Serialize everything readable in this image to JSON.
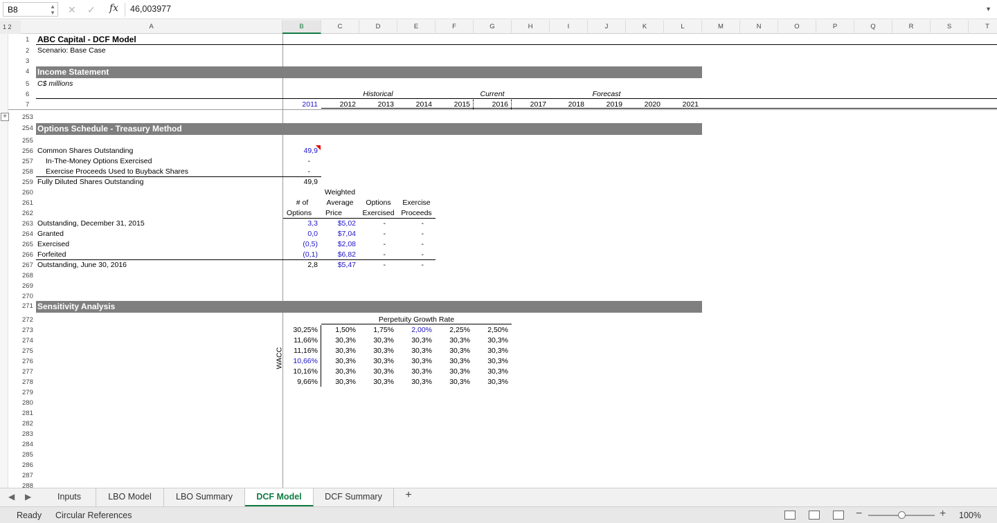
{
  "formula_bar": {
    "name_box": "B8",
    "formula": "46,003977",
    "fx_label": "fx"
  },
  "columns": [
    "A",
    "B",
    "C",
    "D",
    "E",
    "F",
    "G",
    "H",
    "I",
    "J",
    "K",
    "L",
    "M",
    "N",
    "O",
    "P",
    "Q",
    "R",
    "S",
    "T"
  ],
  "outline_levels": "1 2",
  "row_numbers": [
    "1",
    "2",
    "3",
    "4",
    "5",
    "6",
    "7",
    "253",
    "254",
    "255",
    "256",
    "257",
    "258",
    "259",
    "260",
    "261",
    "262",
    "263",
    "264",
    "265",
    "266",
    "267",
    "268",
    "269",
    "270",
    "271",
    "272",
    "273",
    "274",
    "275",
    "276",
    "277",
    "278",
    "279",
    "280",
    "281",
    "282",
    "283",
    "284",
    "285",
    "286",
    "287",
    "288"
  ],
  "header": {
    "title": "ABC Capital - DCF Model",
    "scenario": "Scenario: Base Case",
    "income_statement": "Income Statement",
    "units": "C$ millions",
    "historical": "Historical",
    "current": "Current",
    "forecast": "Forecast",
    "years": [
      "2011",
      "2012",
      "2013",
      "2014",
      "2015",
      "2016",
      "2017",
      "2018",
      "2019",
      "2020",
      "2021"
    ]
  },
  "options": {
    "title": "Options Schedule - Treasury Method",
    "common_label": "Common Shares Outstanding",
    "common_value": "49,9",
    "itm_label": "In-The-Money Options Exercised",
    "itm_value": "-",
    "proceeds_label": "Exercise Proceeds Used to Buyback Shares",
    "proceeds_value": "-",
    "diluted_label": "Fully Diluted Shares Outstanding",
    "diluted_value": "49,9",
    "col_headers": {
      "num_1": "# of",
      "num_2": "Options",
      "wap_1": "Weighted",
      "wap_2": "Average",
      "wap_3": "Price",
      "ex_1": "Options",
      "ex_2": "Exercised",
      "pr_1": "Exercise",
      "pr_2": "Proceeds"
    },
    "rows": [
      {
        "label": "Outstanding, December 31, 2015",
        "num": "3,3",
        "price": "$5,02",
        "exercised": "-",
        "proceeds": "-"
      },
      {
        "label": "Granted",
        "num": "0,0",
        "price": "$7,04",
        "exercised": "-",
        "proceeds": "-"
      },
      {
        "label": "Exercised",
        "num": "(0,5)",
        "price": "$2,08",
        "exercised": "-",
        "proceeds": "-"
      },
      {
        "label": "Forfeited",
        "num": "(0,1)",
        "price": "$6,82",
        "exercised": "-",
        "proceeds": "-"
      },
      {
        "label": "Outstanding, June 30, 2016",
        "num": "2,8",
        "price": "$5,47",
        "exercised": "-",
        "proceeds": "-"
      }
    ]
  },
  "sensitivity": {
    "title": "Sensitivity Analysis",
    "pgr_label": "Perpetuity Growth Rate",
    "wacc_label": "WACC",
    "corner": "30,25%",
    "growth_rates": [
      "1,50%",
      "1,75%",
      "2,00%",
      "2,25%",
      "2,50%"
    ],
    "wacc_values": [
      "11,66%",
      "11,16%",
      "10,66%",
      "10,16%",
      "9,66%"
    ],
    "values": [
      [
        "30,3%",
        "30,3%",
        "30,3%",
        "30,3%",
        "30,3%"
      ],
      [
        "30,3%",
        "30,3%",
        "30,3%",
        "30,3%",
        "30,3%"
      ],
      [
        "30,3%",
        "30,3%",
        "30,3%",
        "30,3%",
        "30,3%"
      ],
      [
        "30,3%",
        "30,3%",
        "30,3%",
        "30,3%",
        "30,3%"
      ],
      [
        "30,3%",
        "30,3%",
        "30,3%",
        "30,3%",
        "30,3%"
      ]
    ]
  },
  "sheet_tabs": [
    "Inputs",
    "LBO Model",
    "LBO Summary",
    "DCF Model",
    "DCF Summary"
  ],
  "active_tab": "DCF Model",
  "status": {
    "ready": "Ready",
    "circular": "Circular References",
    "zoom": "100%"
  }
}
